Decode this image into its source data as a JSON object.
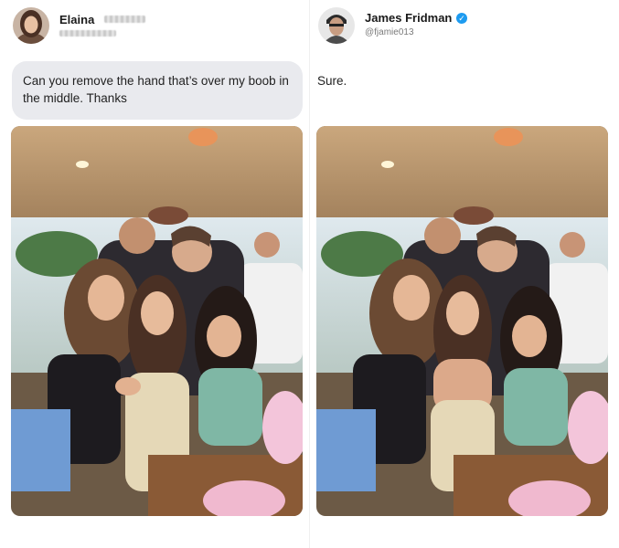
{
  "left": {
    "user": {
      "name": "Elaina",
      "name_obscured": "████",
      "handle_obscured": "@████████"
    },
    "message": "Can you remove the hand that’s over my boob in the middle. Thanks",
    "photo_icon": "group-photo-icon"
  },
  "right": {
    "user": {
      "name": "James Fridman",
      "handle": "@fjamie013",
      "verified_icon": "verified-badge-icon"
    },
    "message": "Sure.",
    "photo_icon": "edited-group-photo-icon"
  },
  "colors": {
    "bubble": "#e9eaee",
    "verified": "#1d9bf0",
    "text": "#222222"
  }
}
